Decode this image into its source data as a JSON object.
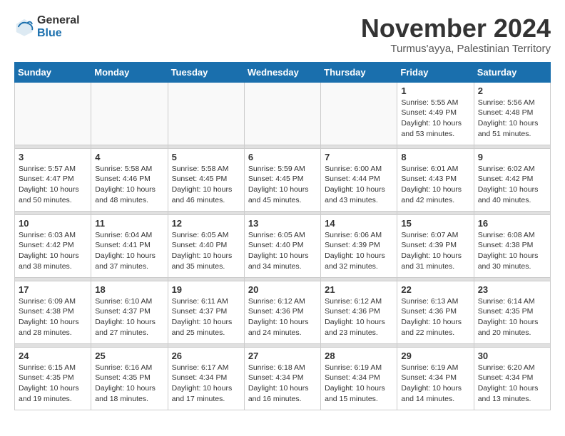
{
  "logo": {
    "general": "General",
    "blue": "Blue"
  },
  "title": "November 2024",
  "location": "Turmus'ayya, Palestinian Territory",
  "days_of_week": [
    "Sunday",
    "Monday",
    "Tuesday",
    "Wednesday",
    "Thursday",
    "Friday",
    "Saturday"
  ],
  "weeks": [
    {
      "days": [
        {
          "num": "",
          "info": ""
        },
        {
          "num": "",
          "info": ""
        },
        {
          "num": "",
          "info": ""
        },
        {
          "num": "",
          "info": ""
        },
        {
          "num": "",
          "info": ""
        },
        {
          "num": "1",
          "info": "Sunrise: 5:55 AM\nSunset: 4:49 PM\nDaylight: 10 hours\nand 53 minutes."
        },
        {
          "num": "2",
          "info": "Sunrise: 5:56 AM\nSunset: 4:48 PM\nDaylight: 10 hours\nand 51 minutes."
        }
      ]
    },
    {
      "days": [
        {
          "num": "3",
          "info": "Sunrise: 5:57 AM\nSunset: 4:47 PM\nDaylight: 10 hours\nand 50 minutes."
        },
        {
          "num": "4",
          "info": "Sunrise: 5:58 AM\nSunset: 4:46 PM\nDaylight: 10 hours\nand 48 minutes."
        },
        {
          "num": "5",
          "info": "Sunrise: 5:58 AM\nSunset: 4:45 PM\nDaylight: 10 hours\nand 46 minutes."
        },
        {
          "num": "6",
          "info": "Sunrise: 5:59 AM\nSunset: 4:45 PM\nDaylight: 10 hours\nand 45 minutes."
        },
        {
          "num": "7",
          "info": "Sunrise: 6:00 AM\nSunset: 4:44 PM\nDaylight: 10 hours\nand 43 minutes."
        },
        {
          "num": "8",
          "info": "Sunrise: 6:01 AM\nSunset: 4:43 PM\nDaylight: 10 hours\nand 42 minutes."
        },
        {
          "num": "9",
          "info": "Sunrise: 6:02 AM\nSunset: 4:42 PM\nDaylight: 10 hours\nand 40 minutes."
        }
      ]
    },
    {
      "days": [
        {
          "num": "10",
          "info": "Sunrise: 6:03 AM\nSunset: 4:42 PM\nDaylight: 10 hours\nand 38 minutes."
        },
        {
          "num": "11",
          "info": "Sunrise: 6:04 AM\nSunset: 4:41 PM\nDaylight: 10 hours\nand 37 minutes."
        },
        {
          "num": "12",
          "info": "Sunrise: 6:05 AM\nSunset: 4:40 PM\nDaylight: 10 hours\nand 35 minutes."
        },
        {
          "num": "13",
          "info": "Sunrise: 6:05 AM\nSunset: 4:40 PM\nDaylight: 10 hours\nand 34 minutes."
        },
        {
          "num": "14",
          "info": "Sunrise: 6:06 AM\nSunset: 4:39 PM\nDaylight: 10 hours\nand 32 minutes."
        },
        {
          "num": "15",
          "info": "Sunrise: 6:07 AM\nSunset: 4:39 PM\nDaylight: 10 hours\nand 31 minutes."
        },
        {
          "num": "16",
          "info": "Sunrise: 6:08 AM\nSunset: 4:38 PM\nDaylight: 10 hours\nand 30 minutes."
        }
      ]
    },
    {
      "days": [
        {
          "num": "17",
          "info": "Sunrise: 6:09 AM\nSunset: 4:38 PM\nDaylight: 10 hours\nand 28 minutes."
        },
        {
          "num": "18",
          "info": "Sunrise: 6:10 AM\nSunset: 4:37 PM\nDaylight: 10 hours\nand 27 minutes."
        },
        {
          "num": "19",
          "info": "Sunrise: 6:11 AM\nSunset: 4:37 PM\nDaylight: 10 hours\nand 25 minutes."
        },
        {
          "num": "20",
          "info": "Sunrise: 6:12 AM\nSunset: 4:36 PM\nDaylight: 10 hours\nand 24 minutes."
        },
        {
          "num": "21",
          "info": "Sunrise: 6:12 AM\nSunset: 4:36 PM\nDaylight: 10 hours\nand 23 minutes."
        },
        {
          "num": "22",
          "info": "Sunrise: 6:13 AM\nSunset: 4:36 PM\nDaylight: 10 hours\nand 22 minutes."
        },
        {
          "num": "23",
          "info": "Sunrise: 6:14 AM\nSunset: 4:35 PM\nDaylight: 10 hours\nand 20 minutes."
        }
      ]
    },
    {
      "days": [
        {
          "num": "24",
          "info": "Sunrise: 6:15 AM\nSunset: 4:35 PM\nDaylight: 10 hours\nand 19 minutes."
        },
        {
          "num": "25",
          "info": "Sunrise: 6:16 AM\nSunset: 4:35 PM\nDaylight: 10 hours\nand 18 minutes."
        },
        {
          "num": "26",
          "info": "Sunrise: 6:17 AM\nSunset: 4:34 PM\nDaylight: 10 hours\nand 17 minutes."
        },
        {
          "num": "27",
          "info": "Sunrise: 6:18 AM\nSunset: 4:34 PM\nDaylight: 10 hours\nand 16 minutes."
        },
        {
          "num": "28",
          "info": "Sunrise: 6:19 AM\nSunset: 4:34 PM\nDaylight: 10 hours\nand 15 minutes."
        },
        {
          "num": "29",
          "info": "Sunrise: 6:19 AM\nSunset: 4:34 PM\nDaylight: 10 hours\nand 14 minutes."
        },
        {
          "num": "30",
          "info": "Sunrise: 6:20 AM\nSunset: 4:34 PM\nDaylight: 10 hours\nand 13 minutes."
        }
      ]
    }
  ]
}
